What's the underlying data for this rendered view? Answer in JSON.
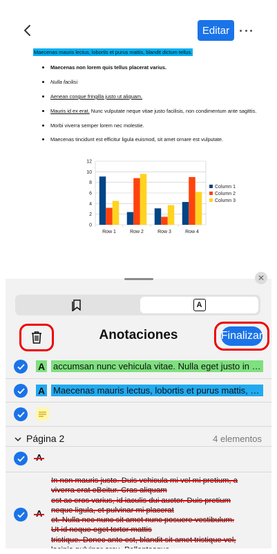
{
  "toolbar": {
    "edit_label": "Editar"
  },
  "document": {
    "highlighted_line": "Maecenas mauris lectus, lobortis et purus mattis, blandit dictum tellus.",
    "bullets": [
      {
        "text": "Maecenas non lorem quis tellus placerat varius.",
        "style": "bold"
      },
      {
        "text": "Nulla facilisi.",
        "style": "italic"
      },
      {
        "text": "Aenean congue fringilla justo ut aliquam.",
        "style": "underline"
      },
      {
        "underlined": "Mauris id ex erat.",
        "rest": " Nunc vulputate neque vitae justo facilisis, non condimentum ante sagittis.",
        "style": "mixed"
      },
      {
        "text": "Morbi viverra semper lorem nec molestie.",
        "style": "normal"
      },
      {
        "text": "Maecenas tincidunt est efficitur ligula euismod, sit amet ornare est vulputate.",
        "style": "normal"
      }
    ]
  },
  "chart_data": {
    "type": "bar",
    "categories": [
      "Row 1",
      "Row 2",
      "Row 3",
      "Row 4"
    ],
    "series": [
      {
        "name": "Column 1",
        "values": [
          9.1,
          2.4,
          3.1,
          4.3
        ],
        "color": "#004586"
      },
      {
        "name": "Column 2",
        "values": [
          3.2,
          8.8,
          1.5,
          9.0
        ],
        "color": "#ff420e"
      },
      {
        "name": "Column 3",
        "values": [
          4.5,
          9.6,
          3.7,
          6.2
        ],
        "color": "#ffd320"
      }
    ],
    "yticks": [
      "0",
      "2",
      "4",
      "6",
      "8",
      "10",
      "12"
    ],
    "ylim": [
      0,
      12
    ],
    "legend": "right",
    "grid": true
  },
  "sheet": {
    "title": "Anotaciones",
    "finish_label": "Finalizar",
    "close_glyph": "✕",
    "tab_left_icon": "bookmarks-icon",
    "tab_right_icon": "annotation-icon",
    "tab_right_glyph": "A",
    "annotations": [
      {
        "glyph": "A",
        "text": "accumsan nunc vehicula vitae. Nulla eget justo in feli...",
        "color": "#7ee07e"
      },
      {
        "glyph": "A",
        "text": "Maecenas mauris lectus, lobortis et purus mattis, bla...",
        "color": "#22aaf0"
      },
      {
        "type": "note",
        "icon": "note-icon",
        "color": "#fff7b0"
      }
    ],
    "page_section": {
      "label": "Página 2",
      "count": "4 elementos"
    },
    "strike_items": [
      {
        "glyph": "A"
      },
      {
        "glyph": "A",
        "lines": [
          "In non mauris justo. Duis vehicula mi vel mi pretium, a",
          "viverra erat eBeitur. Cras aliquam",
          "est ac eros varius, id iaculis dui auctor. Duis pretium",
          "neque ligula, et pulvinar mi placerat",
          "et. Nulla nec nunc sit amet nunc posuere vestibulum.",
          "Ut id neque eget tortor mattis",
          "tristique. Donec ante est, blandit sit amet tristique vel,",
          "lacinia pulvinar arcu. Pellentesque"
        ]
      }
    ]
  }
}
